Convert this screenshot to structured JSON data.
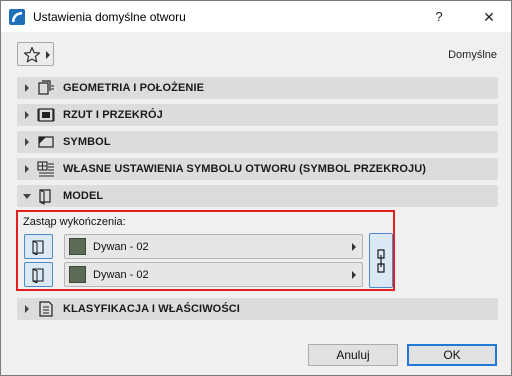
{
  "window": {
    "title": "Ustawienia domyślne otworu",
    "help_label": "?",
    "close_label": "✕"
  },
  "toolbar": {
    "preset_label": "Domyślne"
  },
  "sections": [
    {
      "label": "GEOMETRIA I POŁOŻENIE",
      "icon": "geometry-icon",
      "expanded": false
    },
    {
      "label": "RZUT I PRZEKRÓJ",
      "icon": "floorplan-section-icon",
      "expanded": false
    },
    {
      "label": "SYMBOL",
      "icon": "symbol-icon",
      "expanded": false
    },
    {
      "label": "WŁASNE USTAWIENIA SYMBOLU OTWORU (SYMBOL PRZEKROJU)",
      "icon": "custom-symbol-icon",
      "expanded": false
    },
    {
      "label": "MODEL",
      "icon": "model-icon",
      "expanded": true
    },
    {
      "label": "KLASYFIKACJA I WŁAŚCIWOŚCI",
      "icon": "classification-icon",
      "expanded": false
    }
  ],
  "model": {
    "override_label": "Zastąp wykończenia:",
    "surfaces": [
      {
        "name": "Dywan - 02",
        "swatch_color": "#5b6b55"
      },
      {
        "name": "Dywan - 02",
        "swatch_color": "#5b6b55"
      }
    ]
  },
  "footer": {
    "cancel_label": "Anuluj",
    "ok_label": "OK"
  },
  "colors": {
    "highlight_border": "#e02020",
    "accent": "#4a8cc9"
  }
}
